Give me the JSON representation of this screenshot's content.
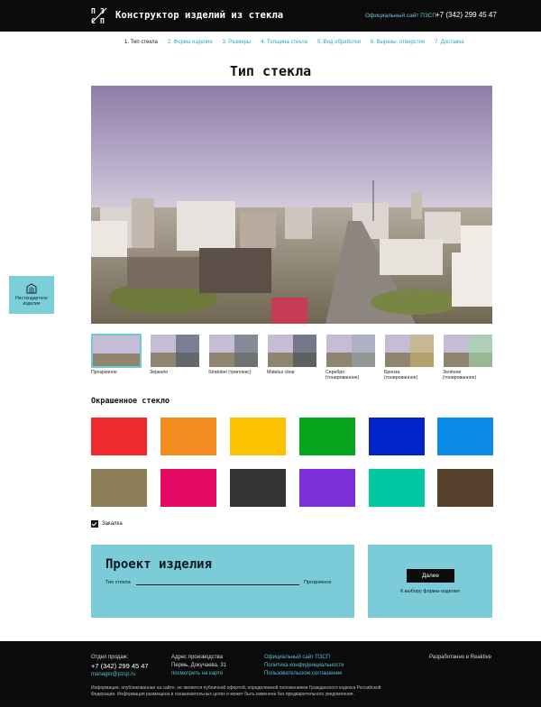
{
  "header": {
    "title": "Конструктор изделий из стекла",
    "official_link": "Официальный сайт ПЗСП",
    "phone": "+7 (342) 299 45 47",
    "logo_chars": [
      "П",
      "З",
      "С",
      "П"
    ]
  },
  "steps": [
    {
      "label": "1. Тип стекла",
      "active": true
    },
    {
      "label": "2. Форма изделия",
      "active": false
    },
    {
      "label": "3. Размеры",
      "active": false
    },
    {
      "label": "4. Толщина стекла",
      "active": false
    },
    {
      "label": "5. Вид обработки",
      "active": false
    },
    {
      "label": "6. Вырезы, отверстия",
      "active": false
    },
    {
      "label": "7. Доставка",
      "active": false
    }
  ],
  "page_title": "Тип стекла",
  "side_button": {
    "label": "Нестандартное изделие",
    "icon": "building-icon"
  },
  "glass_types": [
    {
      "label": "Прозрачное",
      "selected": true,
      "tint": "none"
    },
    {
      "label": "Зеркало",
      "selected": false,
      "tint": "#4a5568"
    },
    {
      "label": "Stratobel (триплекс)",
      "selected": false,
      "tint": "#5a6570"
    },
    {
      "label": "Matelux clear",
      "selected": false,
      "tint": "#3f4a55"
    },
    {
      "label": "Серебро (тонированное)",
      "selected": false,
      "tint": "#9aa7b4"
    },
    {
      "label": "Бронза (тонированное)",
      "selected": false,
      "tint": "#c9b36a"
    },
    {
      "label": "Зелёное (тонированное)",
      "selected": false,
      "tint": "#9fd8a8"
    }
  ],
  "colored_section_title": "Окрашенное стекло",
  "colored_swatches": [
    "#ee2a2e",
    "#f28c1e",
    "#fcc400",
    "#05a51e",
    "#0024c8",
    "#0c8ce6",
    "#8b7d55",
    "#e40a64",
    "#333333",
    "#7a2fd9",
    "#00c8a3",
    "#55412b"
  ],
  "tempering": {
    "label": "Закалка",
    "checked": true
  },
  "project": {
    "title": "Проект изделия",
    "row_key": "Тип стекла",
    "row_value": "Прозрачное"
  },
  "next": {
    "button": "Далее",
    "caption": "К выбору формы изделия"
  },
  "footer": {
    "sales_title": "Отдел продаж:",
    "sales_phone": "+7 (342) 299 45 47",
    "sales_email": "manager@pzsp.ru",
    "address_title": "Адрес производства",
    "address": "Пермь, Докучаева, 31",
    "map_link": "посмотреть на карте",
    "links": [
      "Официальный сайт ПЗСП",
      "Политика конфиденциальности",
      "Пользовательское соглашение"
    ],
    "dev": "Разработанно в Reaktive",
    "note": "Информация, опубликованная на сайте, не является публичной офертой, определяемой положениями Гражданского кодекса Российской Федерации. Информация размещена в ознакомительных целях и может быть изменена без предварительного уведомления."
  },
  "colors": {
    "accent": "#7bccd8",
    "link": "#2ba7c0",
    "dark": "#0b0b0b"
  }
}
